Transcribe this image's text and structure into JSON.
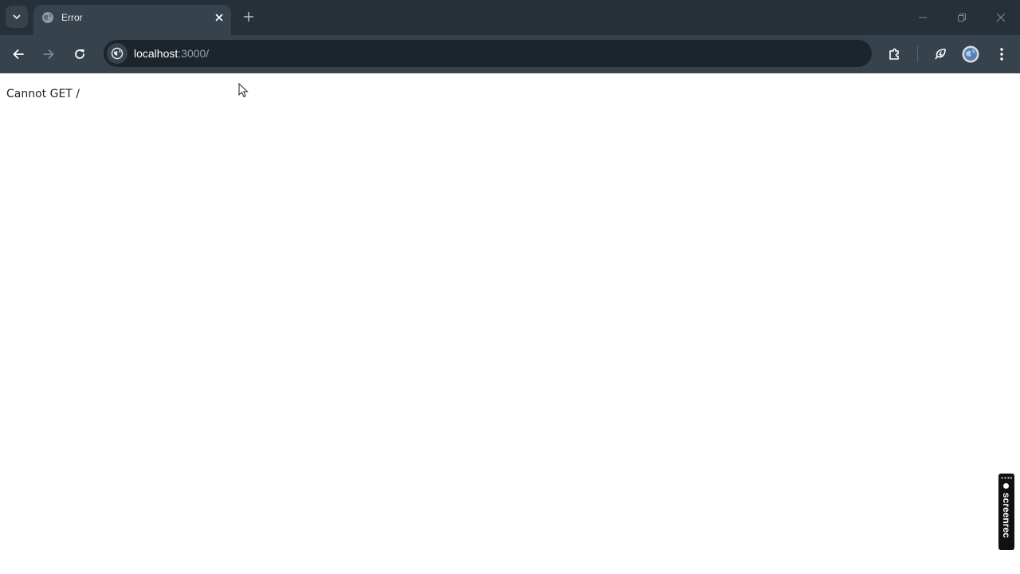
{
  "browser": {
    "tab": {
      "title": "Error",
      "favicon": "globe-icon"
    },
    "omnibox": {
      "host": "localhost",
      "rest": ":3000/"
    },
    "colors": {
      "frame": "#253039",
      "toolbar": "#36434d",
      "omnibox": "#1d252c",
      "icon": "#e8eaed"
    }
  },
  "page": {
    "message": "Cannot GET /"
  },
  "watermark": {
    "label": "screenrec"
  }
}
